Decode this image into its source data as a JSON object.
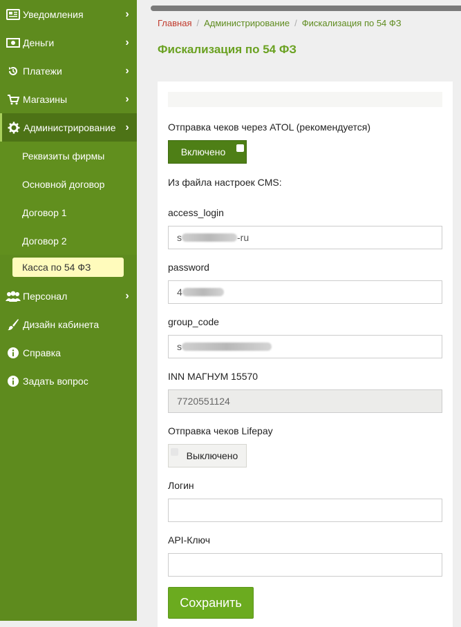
{
  "sidebar": {
    "items": [
      {
        "label": "Уведомления",
        "icon": "newspaper-icon",
        "has_arrow": true
      },
      {
        "label": "Деньги",
        "icon": "money-icon",
        "has_arrow": true
      },
      {
        "label": "Платежи",
        "icon": "history-icon",
        "has_arrow": true
      },
      {
        "label": "Магазины",
        "icon": "cart-icon",
        "has_arrow": true
      },
      {
        "label": "Администрирование",
        "icon": "gear-icon",
        "has_arrow": true,
        "active": true
      },
      {
        "label": "Персонал",
        "icon": "users-icon",
        "has_arrow": true
      },
      {
        "label": "Дизайн кабинета",
        "icon": "brush-icon",
        "has_arrow": false
      },
      {
        "label": "Справка",
        "icon": "info-icon",
        "has_arrow": false
      },
      {
        "label": "Задать вопрос",
        "icon": "info-icon",
        "has_arrow": false
      }
    ],
    "subitems": [
      {
        "label": "Реквизиты фирмы"
      },
      {
        "label": "Основной договор"
      },
      {
        "label": "Договор 1"
      },
      {
        "label": "Договор 2"
      },
      {
        "label": "Касса по 54 ФЗ",
        "active": true
      }
    ]
  },
  "breadcrumb": {
    "home": "Главная",
    "sep": "/",
    "level2": "Администрирование",
    "current": "Фискализация по 54 ФЗ"
  },
  "page": {
    "title": "Фискализация по 54 ФЗ"
  },
  "form": {
    "atol_label": "Отправка чеков через ATOL (рекомендуется)",
    "atol_toggle": "Включено",
    "cms_label": "Из файла настроек CMS:",
    "access_login_label": "access_login",
    "access_login_value_start": "s",
    "access_login_value_end": "-ru",
    "password_label": "password",
    "password_value_start": "4",
    "group_code_label": "group_code",
    "group_code_value_start": "s",
    "inn_label": "INN МАГНУМ 15570",
    "inn_value": "7720551124",
    "lifepay_label": "Отправка чеков Lifepay",
    "lifepay_toggle": "Выключено",
    "login_label": "Логин",
    "login_value": "",
    "api_key_label": "API-Ключ",
    "api_key_value": "",
    "save_label": "Сохранить"
  },
  "colors": {
    "sidebar_bg": "#5e8b1e",
    "accent": "#6aa121",
    "toggle_on": "#4e7f16",
    "active_sub_bg": "#fffbbc",
    "breadcrumb_home": "#c0392b"
  }
}
